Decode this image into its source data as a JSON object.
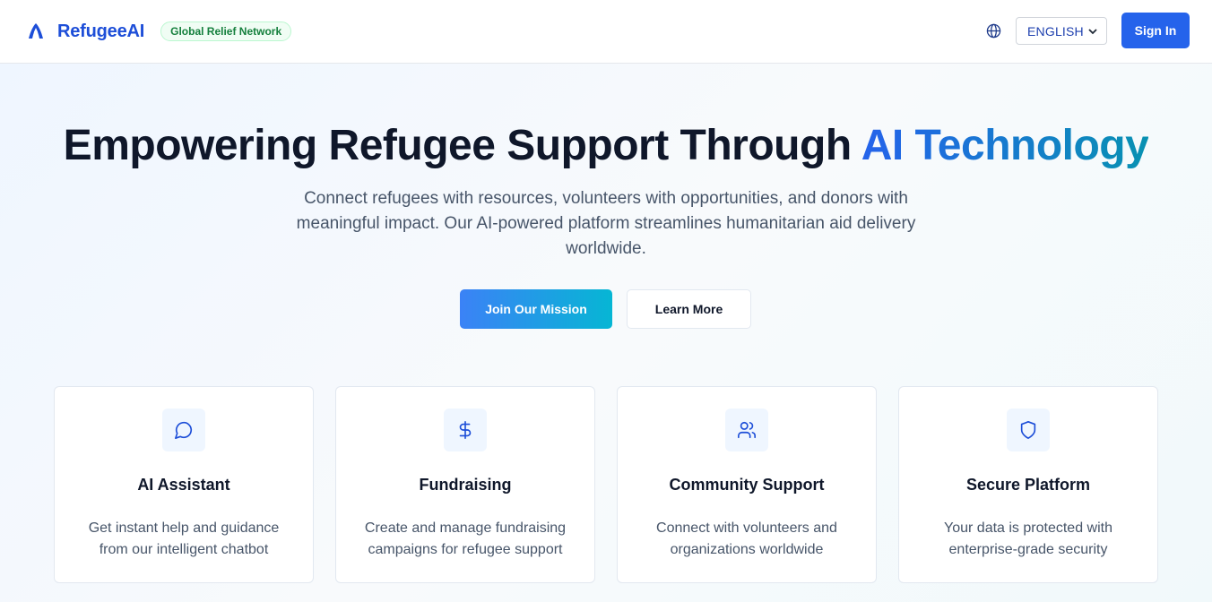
{
  "header": {
    "brand_name": "RefugeeAI",
    "badge": "Global Relief Network",
    "language": "ENGLISH",
    "signin_label": "Sign In"
  },
  "hero": {
    "title_main": "Empowering Refugee Support Through ",
    "title_accent": "AI Technology",
    "subtitle": "Connect refugees with resources, volunteers with opportunities, and donors with meaningful impact. Our AI-powered platform streamlines humanitarian aid delivery worldwide.",
    "primary_button": "Join Our Mission",
    "secondary_button": "Learn More"
  },
  "features": [
    {
      "title": "AI Assistant",
      "description": "Get instant help and guidance from our intelligent chatbot",
      "icon": "chat-icon"
    },
    {
      "title": "Fundraising",
      "description": "Create and manage fundraising campaigns for refugee support",
      "icon": "dollar-icon"
    },
    {
      "title": "Community Support",
      "description": "Connect with volunteers and organizations worldwide",
      "icon": "users-icon"
    },
    {
      "title": "Secure Platform",
      "description": "Your data is protected with enterprise-grade security",
      "icon": "shield-icon"
    }
  ],
  "colors": {
    "brand": "#1d4ed8",
    "primary": "#2563eb",
    "accent_cyan": "#06b6d4",
    "badge_green": "#15803d"
  }
}
